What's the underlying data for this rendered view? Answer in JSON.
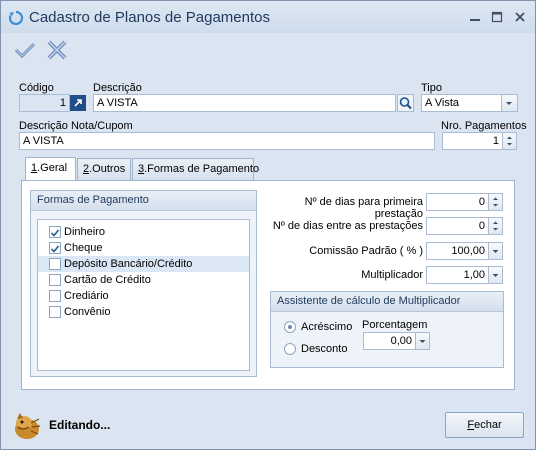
{
  "window": {
    "title": "Cadastro de Planos de Pagamentos",
    "minimize_icon": "minimize-icon",
    "maximize_icon": "maximize-icon",
    "close_icon": "close-icon"
  },
  "toolbar": {
    "confirm_icon": "check-icon",
    "cancel_icon": "cross-icon"
  },
  "form": {
    "codigo_label": "Código",
    "codigo_value": "1",
    "descricao_label": "Descrição",
    "descricao_value": "A VISTA",
    "tipo_label": "Tipo",
    "tipo_value": "A Vista",
    "descricao_nota_label": "Descrição Nota/Cupom",
    "descricao_nota_value": "A VISTA",
    "nro_pagamentos_label": "Nro. Pagamentos",
    "nro_pagamentos_value": "1"
  },
  "tabs": [
    {
      "underline": "1",
      "rest": ".Geral"
    },
    {
      "underline": "2",
      "rest": ".Outros"
    },
    {
      "underline": "3",
      "rest": ".Formas de Pagamento"
    }
  ],
  "formas": {
    "header": "Formas de Pagamento",
    "items": [
      {
        "label": "Dinheiro",
        "checked": true
      },
      {
        "label": "Cheque",
        "checked": true
      },
      {
        "label": "Depósito Bancário/Crédito",
        "checked": false,
        "selected": true
      },
      {
        "label": "Cartão de Crédito",
        "checked": false
      },
      {
        "label": "Crediário",
        "checked": false
      },
      {
        "label": "Convênio",
        "checked": false
      }
    ]
  },
  "params": {
    "dias_primeira_label": "Nº de dias para primeira prestação",
    "dias_primeira_value": "0",
    "dias_entre_label": "Nº de dias entre as prestações",
    "dias_entre_value": "0",
    "comissao_label": "Comissão Padrão ( % )",
    "comissao_value": "100,00",
    "multiplicador_label": "Multiplicador",
    "multiplicador_value": "1,00"
  },
  "assistente": {
    "header": "Assistente de cálculo de Multiplicador",
    "acrescimo_label": "Acréscimo",
    "desconto_label": "Desconto",
    "selected": "Acréscimo",
    "porcentagem_label": "Porcentagem",
    "porcentagem_value": "0,00"
  },
  "status": {
    "text": "Editando...",
    "icon": "mascot-icon"
  },
  "footer": {
    "fechar_underline": "F",
    "fechar_rest": "echar"
  },
  "colors": {
    "accent": "#1e395b",
    "background": "#dbe5f1",
    "selection": "#dce7f5"
  }
}
